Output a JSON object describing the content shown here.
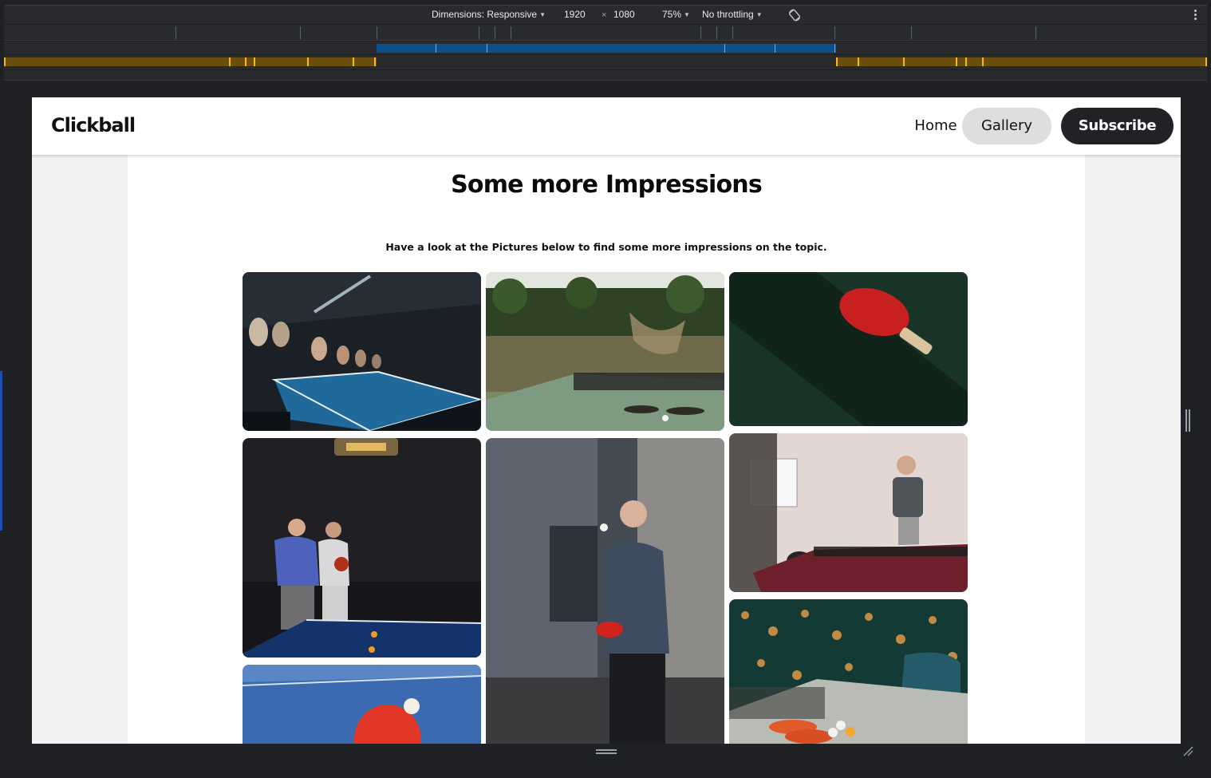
{
  "devtools": {
    "dimensions_label": "Dimensions: Responsive",
    "width": "1920",
    "times": "×",
    "height": "1080",
    "zoom": "75%",
    "throttling": "No throttling",
    "icons": [
      "rotate-icon",
      "more-options-icon",
      "resize-handle-icon"
    ]
  },
  "site": {
    "logo": "Clickball",
    "nav": {
      "home": "Home",
      "gallery": "Gallery",
      "subscribe": "Subscribe"
    }
  },
  "page": {
    "title": "Some more Impressions",
    "subtitle": "Have a look at the Pictures below to find some more impressions on the topic."
  },
  "gallery": {
    "photos": [
      "table-tennis-hall-photo",
      "outdoor-table-tennis-photo",
      "red-paddle-photo",
      "two-players-dark-room-photo",
      "player-serving-photo",
      "office-table-tennis-photo",
      "paddle-and-ball-photo",
      "paddles-on-table-photo"
    ]
  },
  "colors": {
    "accent_dark": "#212126",
    "gallery_pill": "#dedede",
    "devtools_bg": "#202124",
    "media_query_blue": "#0c4f8c",
    "media_query_orange": "#6b4d0c"
  }
}
